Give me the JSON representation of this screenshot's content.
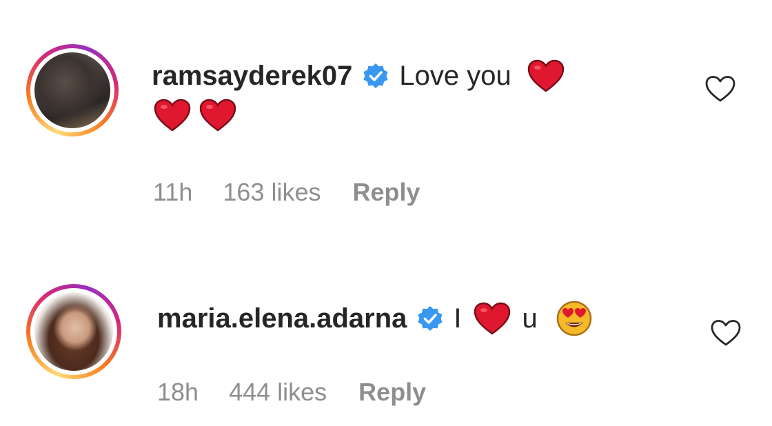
{
  "comments": [
    {
      "username": "ramsayderek07",
      "verified": true,
      "text": "Love you",
      "time": "11h",
      "likes": "163 likes",
      "reply_label": "Reply"
    },
    {
      "username": "maria.elena.adarna",
      "verified": true,
      "text_before": "I",
      "text_after": "u",
      "time": "18h",
      "likes": "444 likes",
      "reply_label": "Reply"
    }
  ],
  "colors": {
    "heart": "#e0182f",
    "verified": "#3897f0",
    "meta_text": "#8e8e8e",
    "primary_text": "#262626"
  },
  "icons": {
    "verified": "verified-badge-icon",
    "heart_emoji": "red-heart-emoji",
    "heart_eyes_emoji": "heart-eyes-emoji",
    "like": "heart-outline-icon"
  }
}
